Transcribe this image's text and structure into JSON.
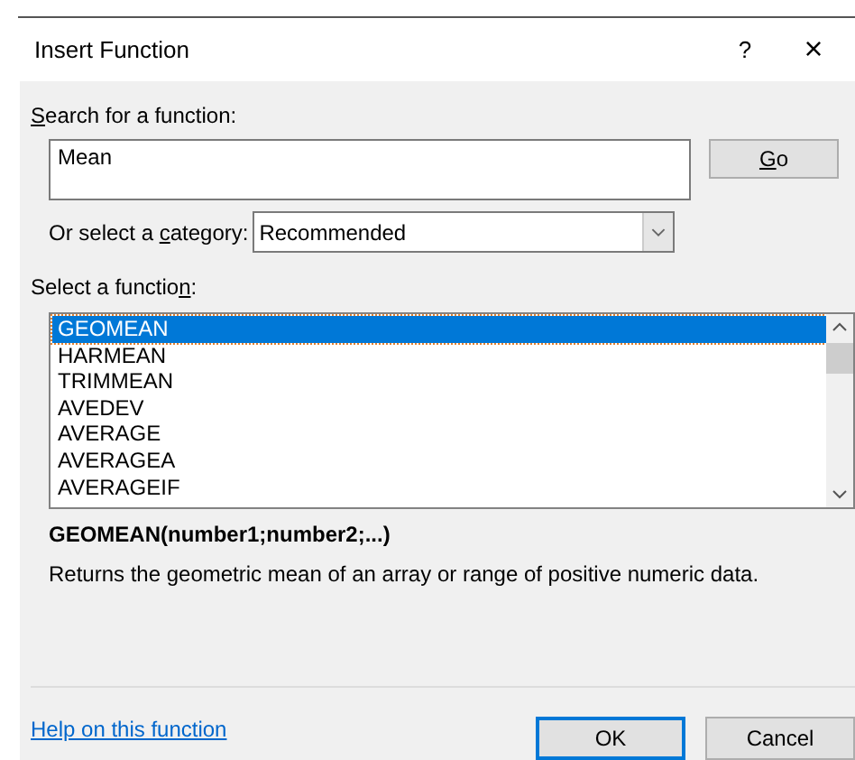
{
  "window": {
    "title": "Insert Function",
    "help_button": "?",
    "close_button": "×"
  },
  "search": {
    "label": {
      "key": "S",
      "after": "earch for a function:"
    },
    "value": "Mean",
    "go_button": {
      "key": "G",
      "after": "o"
    }
  },
  "category": {
    "label": {
      "before": "Or select a ",
      "key": "c",
      "after": "ategory:"
    },
    "value": "Recommended"
  },
  "functions": {
    "label": {
      "before": "Select a functio",
      "key": "n",
      "after": ":"
    },
    "items": [
      {
        "name": "GEOMEAN",
        "selected": true
      },
      {
        "name": "HARMEAN",
        "selected": false
      },
      {
        "name": "TRIMMEAN",
        "selected": false
      },
      {
        "name": "AVEDEV",
        "selected": false
      },
      {
        "name": "AVERAGE",
        "selected": false
      },
      {
        "name": "AVERAGEA",
        "selected": false
      },
      {
        "name": "AVERAGEIF",
        "selected": false
      }
    ]
  },
  "signature": "GEOMEAN(number1;number2;...)",
  "description": "Returns the geometric mean of an array or range of positive numeric data.",
  "help_link": "Help on this function",
  "buttons": [
    {
      "label": "OK",
      "default": true
    },
    {
      "label": "Cancel",
      "default": false
    }
  ]
}
